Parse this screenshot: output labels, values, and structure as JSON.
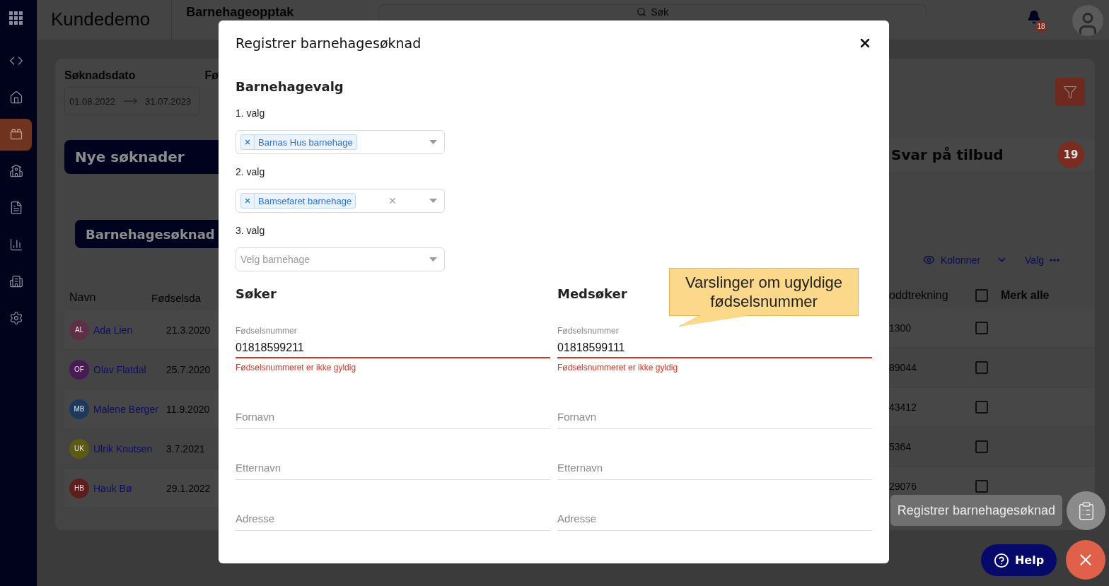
{
  "header": {
    "app_name": "Kundedemo",
    "module": "Barnehageopptak",
    "search": {
      "placeholder": "Søk"
    },
    "notifications": {
      "count": "18"
    }
  },
  "sidebar": {
    "items": [
      {
        "kind": "code",
        "selected": false
      },
      {
        "kind": "home",
        "selected": false
      },
      {
        "kind": "bricks",
        "selected": true
      },
      {
        "kind": "school",
        "selected": false
      },
      {
        "kind": "document",
        "selected": false
      },
      {
        "kind": "chart",
        "selected": false
      },
      {
        "kind": "building",
        "selected": false
      },
      {
        "kind": "settings",
        "selected": false
      }
    ]
  },
  "filters": {
    "date_label": "Søknadsdato",
    "from": "01.08.2022",
    "to": "31.07.2023",
    "next_label": "Fø"
  },
  "status_tabs": [
    {
      "label": "Nye søknader",
      "selected": true
    },
    {
      "label": "Svar på tilbud",
      "count": "19",
      "selected": false
    }
  ],
  "list_tab": {
    "label": "Barnehagesøknad"
  },
  "toolbar": {
    "columns": "Kolonner",
    "options": "Valg"
  },
  "table": {
    "columns": [
      "Navn",
      "Fødselsda",
      "oddtrekning",
      "Merk alle"
    ],
    "select_all_checked": false,
    "rows": [
      {
        "initials": "AL",
        "color": "#5e3048",
        "name": "Ada Lien",
        "birth": "21.3.2020",
        "number": "1300",
        "checked": false
      },
      {
        "initials": "OF",
        "color": "#4a1a55",
        "name": "Olav Flatdal",
        "birth": "25.7.2020",
        "number": "89044",
        "checked": false
      },
      {
        "initials": "MB",
        "color": "#1d3a5e",
        "name": "Malene Berger",
        "birth": "11.9.2020",
        "number": "43412",
        "checked": false
      },
      {
        "initials": "UK",
        "color": "#5c5a14",
        "name": "Ulrik Knutsen",
        "birth": "3.7.2021",
        "number": "5364",
        "checked": false
      },
      {
        "initials": "HB",
        "color": "#5e1e1e",
        "name": "Hauk Bø",
        "birth": "29.1.2022",
        "number": "29076",
        "checked": false
      }
    ]
  },
  "dialog": {
    "title": "Registrer barnehagesøknad",
    "section": "Barnehagevalg",
    "choices": [
      {
        "label": "1. valg",
        "value": "Barnas Hus barnehage",
        "clearable": false
      },
      {
        "label": "2. valg",
        "value": "Bamsefaret barnehage",
        "clearable": true
      },
      {
        "label": "3. valg",
        "placeholder": "Velg barnehage",
        "clearable": false
      }
    ],
    "parties": [
      {
        "heading": "Søker",
        "fields": [
          {
            "kind": "filled",
            "label": "Fødselsnummer",
            "value": "01818599211",
            "error": "Fødselsnummeret er ikke gyldig"
          },
          {
            "kind": "empty",
            "placeholder": "Fornavn"
          },
          {
            "kind": "empty",
            "placeholder": "Etternavn"
          },
          {
            "kind": "empty",
            "placeholder": "Adresse"
          }
        ]
      },
      {
        "heading": "Medsøker",
        "fields": [
          {
            "kind": "filled",
            "label": "Fødselsnummer",
            "value": "01818599111",
            "error": "Fødselsnummeret er ikke gyldig"
          },
          {
            "kind": "empty",
            "placeholder": "Fornavn"
          },
          {
            "kind": "empty",
            "placeholder": "Etternavn"
          },
          {
            "kind": "empty",
            "placeholder": "Adresse"
          }
        ]
      }
    ]
  },
  "annotation": {
    "text": "Varslinger om ugyldige fødselsnummer"
  },
  "floating": {
    "tooltip": "Registrer barnehagesøknad",
    "help": "Help"
  }
}
